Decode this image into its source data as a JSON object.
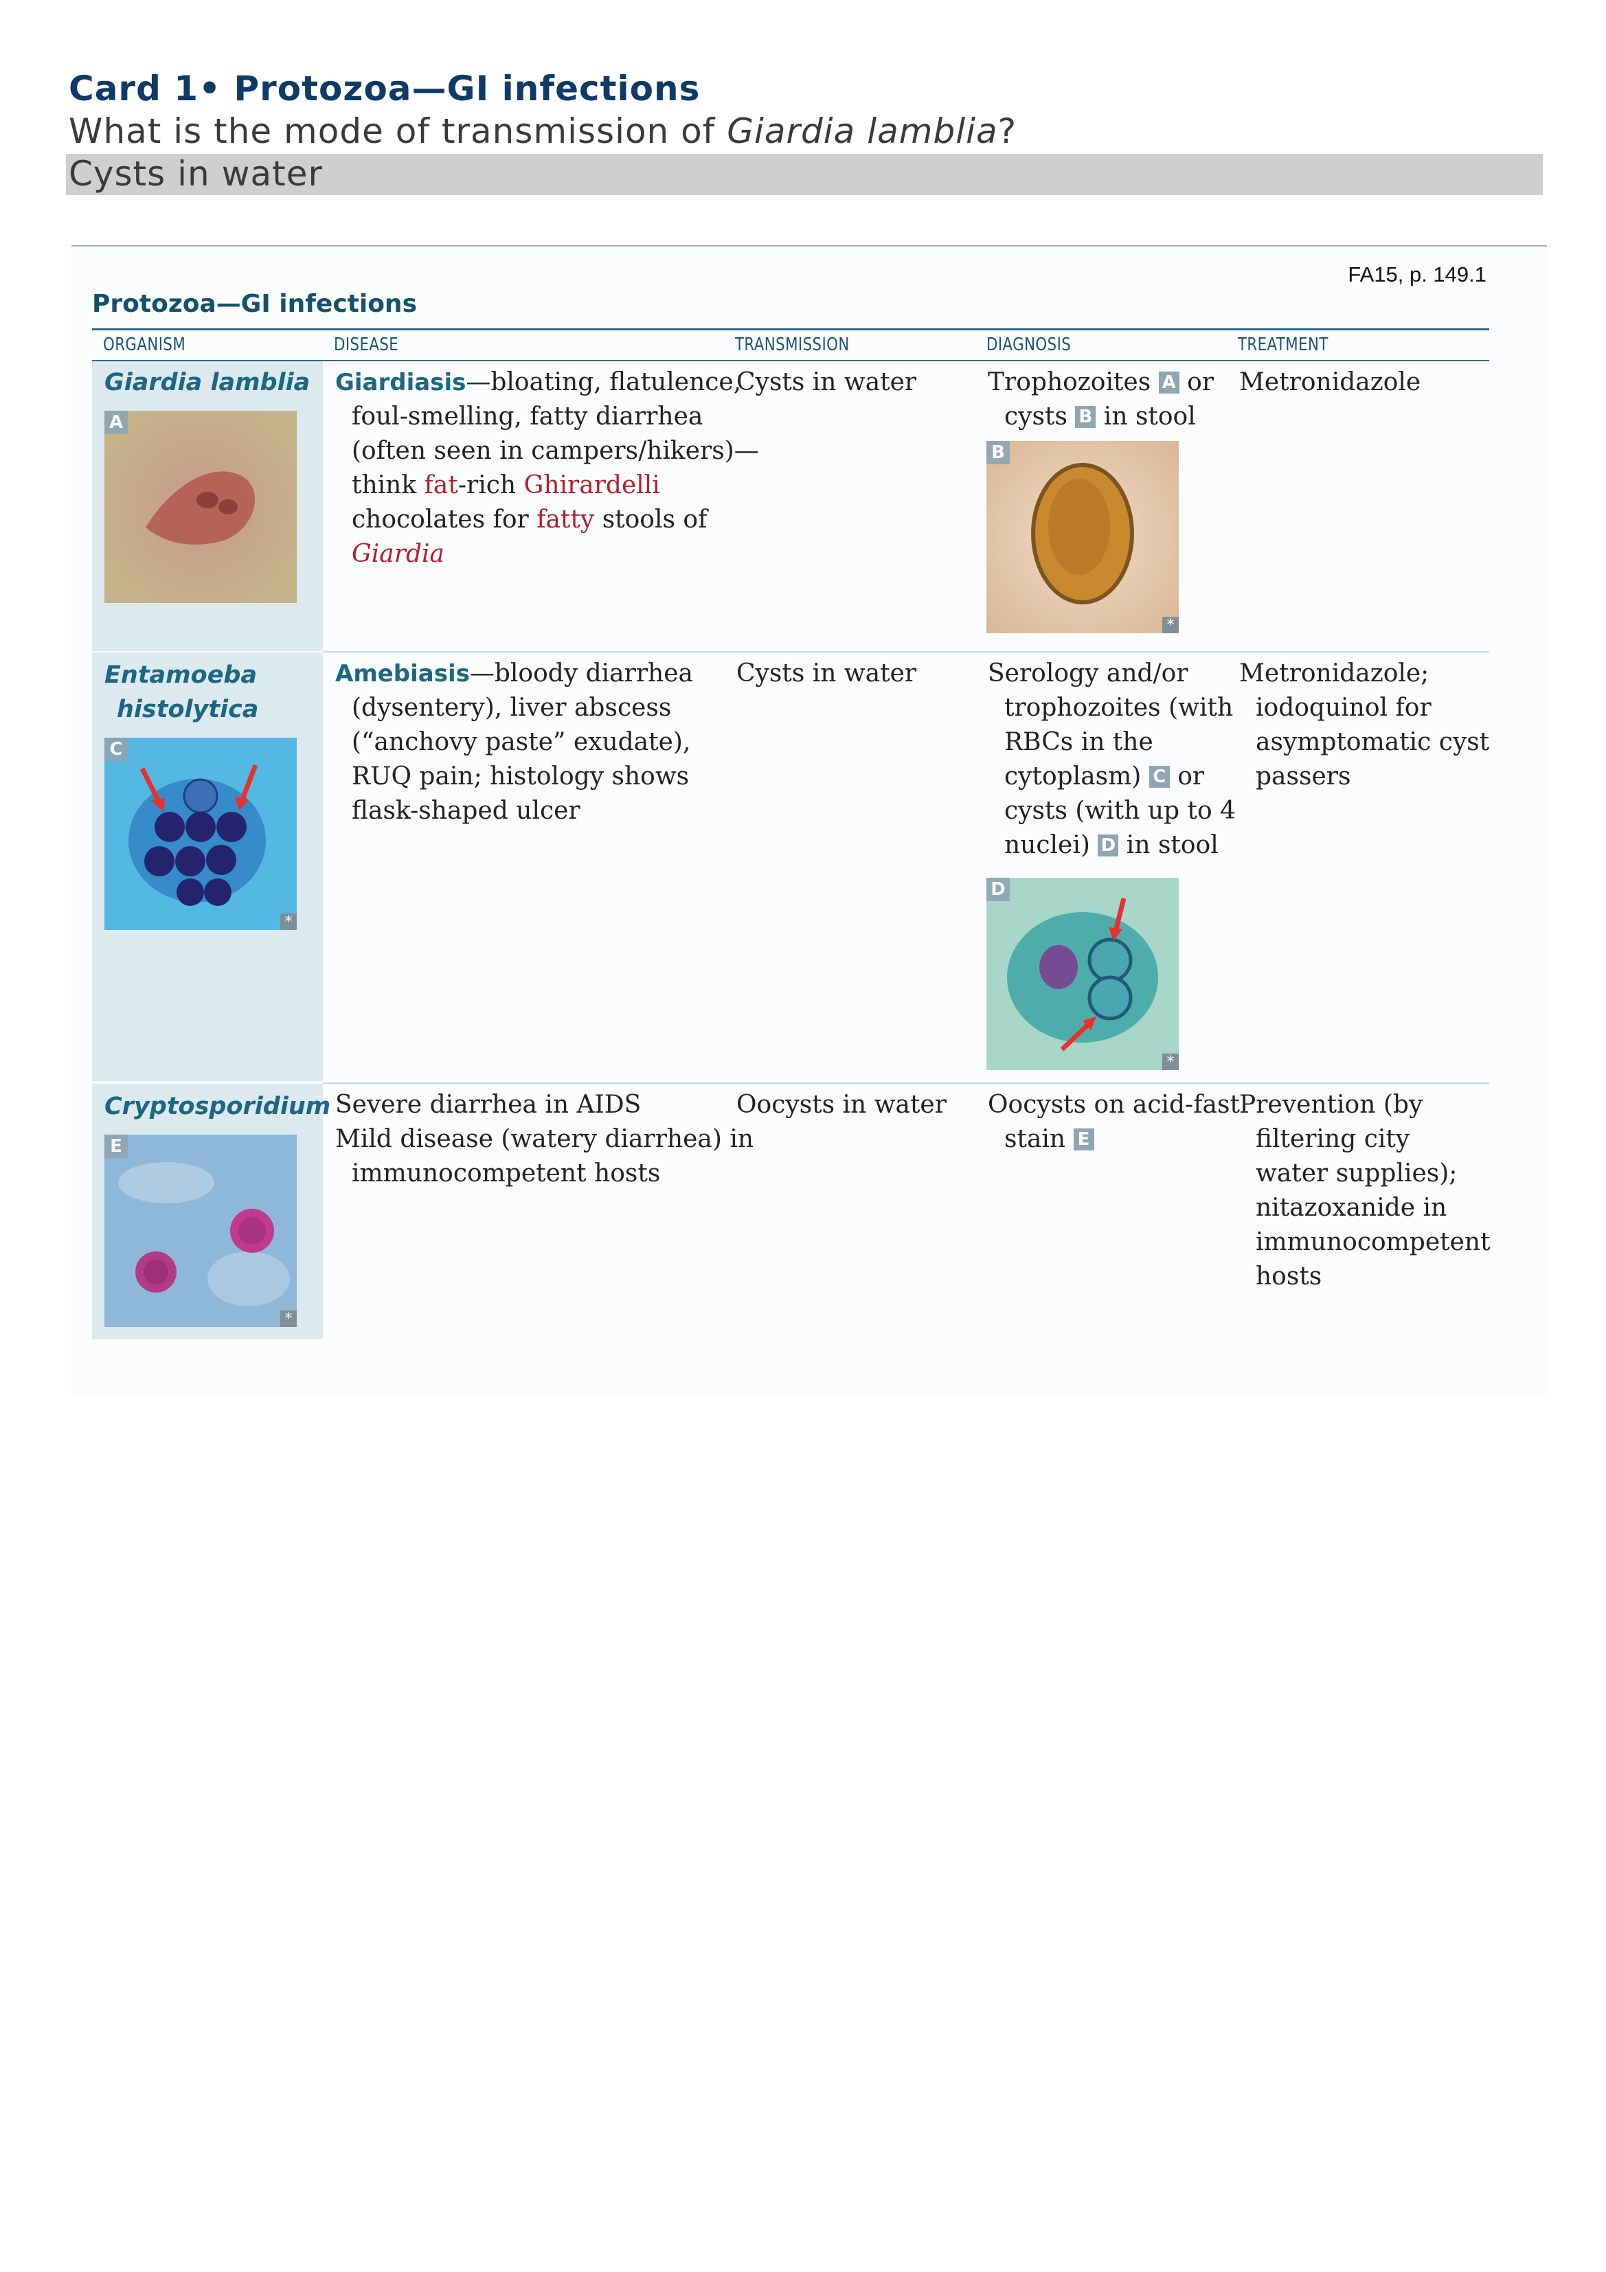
{
  "card": {
    "title": "Card 1• Protozoa—GI infections",
    "question_prefix": "What is the mode of transmission of ",
    "question_italic": "Giardia lamblia",
    "question_suffix": "?",
    "answer": "Cysts in water"
  },
  "page": {
    "reference": "FA15, p. 149.1",
    "section_title": "Protozoa—GI infections",
    "headers": [
      "ORGANISM",
      "DISEASE",
      "TRANSMISSION",
      "DIAGNOSIS",
      "TREATMENT"
    ],
    "rows": [
      {
        "organism": [
          "Giardia lamblia"
        ],
        "image_label": "A",
        "disease_keyword": "Giardiasis",
        "disease_lines": [
          "—bloating, flatulence,",
          "foul-smelling, fatty diarrhea",
          "(often seen in campers/hikers)—"
        ],
        "mnemonic": {
          "a": "think ",
          "b": "fat",
          "c": "-rich ",
          "d": "Ghirardelli",
          "e": "chocolates for ",
          "f": "fatty",
          "g": " stools of",
          "h": "Giardia"
        },
        "transmission": "Cysts in water",
        "diagnosis": {
          "a": "Trophozoites ",
          "label_a": "A",
          "b": " or",
          "c": "cysts ",
          "label_b": "B",
          "d": " in stool",
          "image_label": "B"
        },
        "treatment": [
          "Metronidazole"
        ]
      },
      {
        "organism": [
          "Entamoeba",
          "histolytica"
        ],
        "image_label": "C",
        "disease_keyword": "Amebiasis",
        "disease_lines": [
          "—bloody diarrhea",
          "(dysentery), liver abscess",
          "(“anchovy paste” exudate),",
          "RUQ pain; histology shows",
          "flask-shaped ulcer"
        ],
        "transmission": "Cysts in water",
        "diagnosis": {
          "l1": "Serology and/or",
          "l2": "trophozoites (with",
          "l3": "RBCs in the",
          "l4a": "cytoplasm) ",
          "label_c": "C",
          "l4b": " or",
          "l5": "cysts (with up to 4",
          "l6a": "nuclei) ",
          "label_d": "D",
          "l6b": " in stool",
          "image_label": "D"
        },
        "treatment": [
          "Metronidazole;",
          "iodoquinol for",
          "asymptomatic cyst",
          "passers"
        ]
      },
      {
        "organism": [
          "Cryptosporidium"
        ],
        "image_label": "E",
        "disease_lines": [
          "Severe diarrhea in AIDS",
          "Mild disease (watery diarrhea) in",
          "immunocompetent hosts"
        ],
        "transmission": "Oocysts in water",
        "diagnosis": {
          "l1": "Oocysts on acid-fast",
          "l2a": "stain ",
          "label_e": "E"
        },
        "treatment": [
          "Prevention (by",
          "filtering city",
          "water supplies);",
          "nitazoxanide in",
          "immunocompetent",
          "hosts"
        ]
      }
    ],
    "image_marker": "*"
  },
  "colors": {
    "title_blue": "#0e3a66",
    "keyword_blue": "#1c6784",
    "mnemonic_red": "#b3202a",
    "organism_column": "#dce9ef",
    "answer_bar": "#cfcfcf"
  }
}
